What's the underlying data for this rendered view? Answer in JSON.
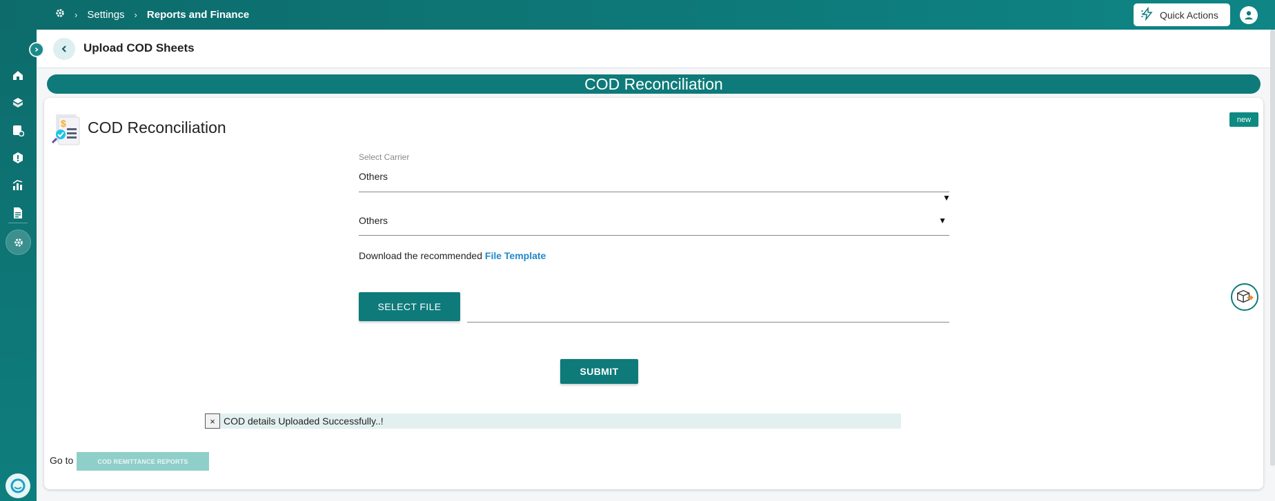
{
  "breadcrumb": {
    "settings": "Settings",
    "current": "Reports and Finance"
  },
  "header": {
    "quick_actions": "Quick Actions"
  },
  "page": {
    "title": "Upload COD Sheets"
  },
  "banner": {
    "title": "COD Reconciliation"
  },
  "card": {
    "title": "COD Reconciliation",
    "badge": "new",
    "carrier_label": "Select Carrier",
    "carrier_value": "Others",
    "second_select_value": "Others",
    "download_prefix": "Download the recommended",
    "download_link": "File Template",
    "select_file_label": "SELECT FILE",
    "submit_label": "SUBMIT",
    "toast_close": "×",
    "toast_message": "COD details Uploaded Successfully..!",
    "goto_label": "Go to",
    "cod_report_button": "COD REMITTANCE REPORTS"
  },
  "icons": [
    "logo-icon",
    "gear-icon",
    "home-icon",
    "box-icon",
    "orders-icon",
    "alert-icon",
    "analytics-icon",
    "document-icon",
    "settings-icon",
    "chat-icon",
    "bolt-icon",
    "user-icon",
    "back-arrow-icon",
    "dropdown-arrow-icon",
    "bot-icon"
  ],
  "colors": {
    "primary": "#0e7a7a",
    "link": "#1e88c8",
    "toast_bg": "#e2f1ef",
    "badge": "#0e8a82"
  }
}
